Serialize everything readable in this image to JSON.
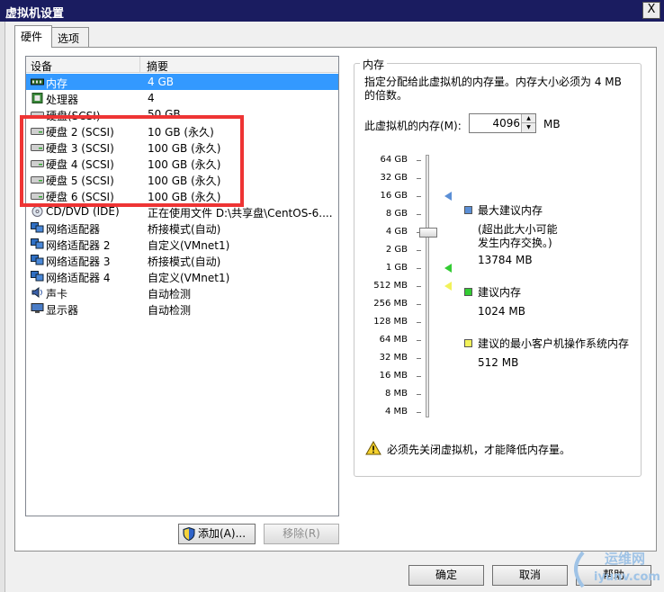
{
  "window": {
    "title": "虚拟机设置",
    "close_glyph": "X"
  },
  "tabs": [
    {
      "label": "硬件",
      "active": true
    },
    {
      "label": "选项",
      "active": false
    }
  ],
  "device_list": {
    "columns": [
      "设备",
      "摘要"
    ],
    "rows": [
      {
        "name": "内存",
        "summary": "4 GB",
        "icon": "memory-icon",
        "selected": true
      },
      {
        "name": "处理器",
        "summary": "4",
        "icon": "processor-icon"
      },
      {
        "name": "硬盘(SCSI)",
        "summary": "50 GB",
        "icon": "hard-disk-icon"
      },
      {
        "name": "硬盘 2 (SCSI)",
        "summary": "10 GB (永久)",
        "icon": "hard-disk-icon"
      },
      {
        "name": "硬盘 3 (SCSI)",
        "summary": "100 GB (永久)",
        "icon": "hard-disk-icon"
      },
      {
        "name": "硬盘 4 (SCSI)",
        "summary": "100 GB (永久)",
        "icon": "hard-disk-icon"
      },
      {
        "name": "硬盘 5 (SCSI)",
        "summary": "100 GB (永久)",
        "icon": "hard-disk-icon"
      },
      {
        "name": "硬盘 6 (SCSI)",
        "summary": "100 GB (永久)",
        "icon": "hard-disk-icon"
      },
      {
        "name": "CD/DVD (IDE)",
        "summary": "正在使用文件 D:\\共享盘\\CentOS-6....",
        "icon": "cd-dvd-icon"
      },
      {
        "name": "网络适配器",
        "summary": "桥接模式(自动)",
        "icon": "network-adapter-icon"
      },
      {
        "name": "网络适配器 2",
        "summary": "自定义(VMnet1)",
        "icon": "network-adapter-icon"
      },
      {
        "name": "网络适配器 3",
        "summary": "桥接模式(自动)",
        "icon": "network-adapter-icon"
      },
      {
        "name": "网络适配器 4",
        "summary": "自定义(VMnet1)",
        "icon": "network-adapter-icon"
      },
      {
        "name": "声卡",
        "summary": "自动检测",
        "icon": "sound-card-icon"
      },
      {
        "name": "显示器",
        "summary": "自动检测",
        "icon": "display-icon"
      }
    ]
  },
  "buttons": {
    "add": "添加(A)...",
    "remove": "移除(R)",
    "ok": "确定",
    "cancel": "取消",
    "help": "帮助"
  },
  "memory_panel": {
    "group_title": "内存",
    "description": "指定分配给此虚拟机的内存量。内存大小必须为 4 MB 的倍数。",
    "memory_label": "此虚拟机的内存(M):",
    "memory_value": "4096",
    "unit": "MB",
    "slider_ticks": [
      "64 GB",
      "32 GB",
      "16 GB",
      "8 GB",
      "4 GB",
      "2 GB",
      "1 GB",
      "512 MB",
      "256 MB",
      "128 MB",
      "64 MB",
      "32 MB",
      "16 MB",
      "8 MB",
      "4 MB"
    ],
    "slider_value_mb": 4096,
    "legend": {
      "max_recommended": {
        "title": "最大建议内存",
        "note_line1": "(超出此大小可能",
        "note_line2": "发生内存交换。)",
        "value": "13784 MB",
        "color": "#5b8fd6"
      },
      "recommended": {
        "title": "建议内存",
        "value": "1024 MB",
        "color": "#33cc33"
      },
      "min_guest": {
        "title": "建议的最小客户机操作系统内存",
        "value": "512 MB",
        "color": "#f2f25a"
      }
    },
    "warning": "必须先关闭虚拟机，才能降低内存量。"
  },
  "watermark": {
    "line1": "运维网",
    "line2": "iyunv.com"
  },
  "colors": {
    "titlebar": "#1a1c60",
    "selection": "#3399ff",
    "highlight_border": "#ee3434"
  }
}
